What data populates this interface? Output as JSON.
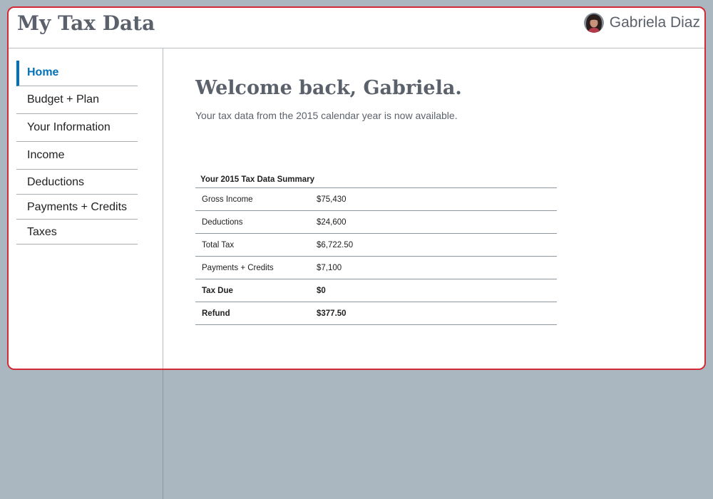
{
  "header": {
    "app_title": "My Tax Data",
    "user_name": "Gabriela Diaz"
  },
  "sidebar": {
    "items": [
      {
        "label": "Home",
        "active": true
      },
      {
        "label": "Budget + Plan"
      },
      {
        "label": "Your Information"
      },
      {
        "label": "Income"
      },
      {
        "label": "Deductions"
      },
      {
        "label": "Payments + Credits"
      },
      {
        "label": "Taxes"
      }
    ]
  },
  "main": {
    "welcome": "Welcome back, Gabriela.",
    "subtitle": "Your tax data from the 2015 calendar year is now available.",
    "summary": {
      "title": "Your 2015 Tax Data Summary",
      "rows": [
        {
          "label": "Gross Income",
          "value": "$75,430"
        },
        {
          "label": "Deductions",
          "value": "$24,600"
        },
        {
          "label": "Total Tax",
          "value": "$6,722.50"
        },
        {
          "label": "Payments + Credits",
          "value": "$7,100"
        },
        {
          "label": "Tax Due",
          "value": "$0",
          "bold": true
        },
        {
          "label": "Refund",
          "value": "$377.50",
          "bold": true
        }
      ]
    }
  },
  "colors": {
    "background": "#aab7c0",
    "window_border": "#d32b35",
    "accent": "#0071bb",
    "heading": "#5b616b",
    "text": "#212121"
  }
}
